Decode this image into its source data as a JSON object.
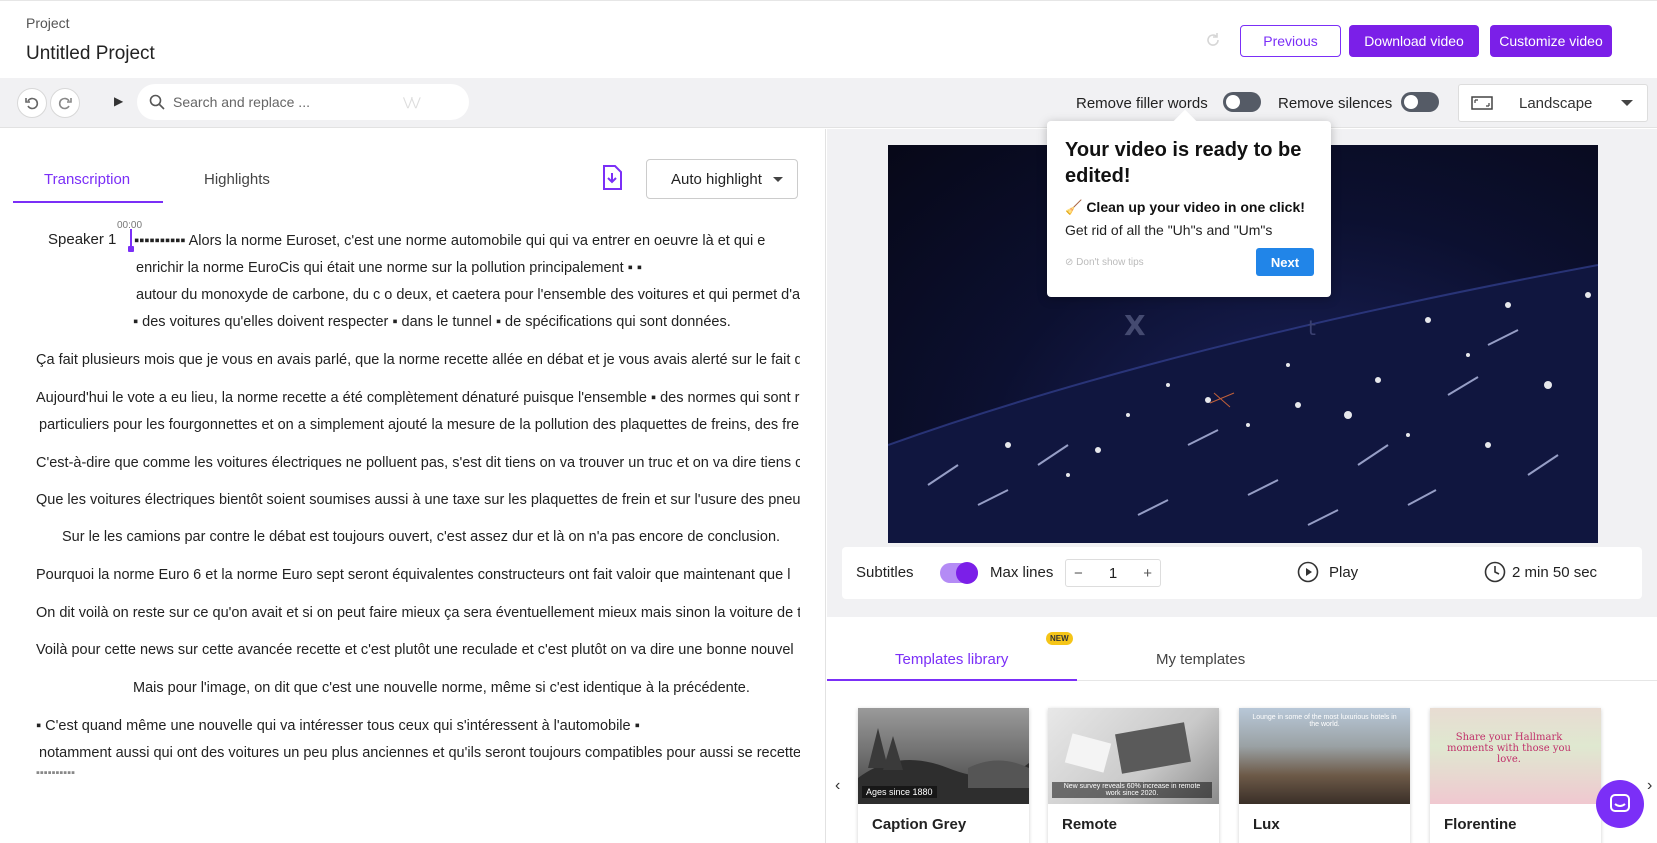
{
  "header": {
    "project_label": "Project",
    "project_title": "Untitled Project",
    "previous_label": "Previous",
    "download_label": "Download video",
    "customize_label": "Customize video"
  },
  "toolbar": {
    "search_placeholder": "Search and replace ...",
    "filler_label": "Remove filler words",
    "silences_label": "Remove silences",
    "orientation_value": "Landscape"
  },
  "transcript": {
    "tabs": [
      "Transcription",
      "Highlights"
    ],
    "auto_highlight_label": "Auto highlight",
    "speaker": "Speaker 1",
    "timecode": "00:00",
    "lines": [
      "▪▪▪▪▪▪▪▪▪▪ Alors la norme Euroset, c'est une norme automobile qui qui va entrer en oeuvre là et qui e",
      "enrichir la norme EuroCis qui était une norme sur la pollution principalement ▪ ▪",
      "autour du monoxyde de carbone, du c o deux, et caetera pour l'ensemble des voitures et qui permet d'av",
      "▪ des voitures qu'elles doivent respecter ▪ dans le tunnel ▪ de spécifications qui sont données.",
      "Ça fait plusieurs mois que je vous en avais parlé, que la norme recette allée en débat et je vous avais alerté sur le fait qu",
      "Aujourd'hui le vote a eu lieu, la norme recette a été complètement dénaturé puisque l'ensemble ▪ des normes qui sont r",
      "particuliers pour les fourgonnettes et on a simplement ajouté la mesure de la pollution des plaquettes de freins, des fre",
      "C'est-à-dire que comme les voitures électriques ne polluent pas, s'est dit tiens on va trouver un truc et on va dire tiens c",
      "Que les voitures électriques bientôt soient soumises aussi à une taxe sur les plaquettes de frein et sur l'usure des pneus",
      "Sur le les camions par contre le débat est toujours ouvert, c'est assez dur et là on n'a pas encore de conclusion.",
      "Pourquoi la norme Euro 6 et la norme Euro sept seront équivalentes constructeurs ont fait valoir que maintenant que l",
      "On dit voilà on reste sur ce qu'on avait et si on peut faire mieux ça sera éventuellement mieux mais sinon la voiture de t",
      "Voilà pour cette news sur cette avancée recette et c'est plutôt une reculade et c'est plutôt on va dire une bonne nouvel",
      "Mais pour l'image, on dit que c'est une nouvelle norme, même si c'est identique à la précédente.",
      "▪ C'est quand même une nouvelle qui va intéresser tous ceux qui s'intéressent à l'automobile ▪",
      "notamment aussi qui ont des voitures un peu plus anciennes et qu'ils seront toujours compatibles pour aussi se recette",
      "▪▪▪▪▪▪▪▪▪▪"
    ]
  },
  "tooltip": {
    "title": "Your video is ready to be edited!",
    "subtitle": "🧹 Clean up your video in one click!",
    "body": "Get rid of all the \"Uh\"s and \"Um\"s",
    "dont_show": "⊘ Don't show tips",
    "next_label": "Next"
  },
  "video": {
    "overlay_letters": [
      "X",
      "t"
    ]
  },
  "player": {
    "subtitles_label": "Subtitles",
    "subtitles_on": true,
    "max_lines_label": "Max lines",
    "max_lines_value": "1",
    "play_label": "Play",
    "duration": "2 min 50 sec"
  },
  "templates": {
    "tabs": [
      "Templates library",
      "My templates"
    ],
    "new_badge": "NEW",
    "cards": [
      {
        "name": "Caption Grey",
        "caption": "Ages since 1880"
      },
      {
        "name": "Remote",
        "caption": "New survey reveals 60% increase in remote work since 2020."
      },
      {
        "name": "Lux",
        "caption": "Lounge in some of the most luxurious hotels in the world."
      },
      {
        "name": "Florentine",
        "caption": "Share your Hallmark moments with those you love."
      }
    ]
  },
  "colors": {
    "accent": "#7b1fe8",
    "next_blue": "#2185e8",
    "toggle_off": "#555b66"
  }
}
